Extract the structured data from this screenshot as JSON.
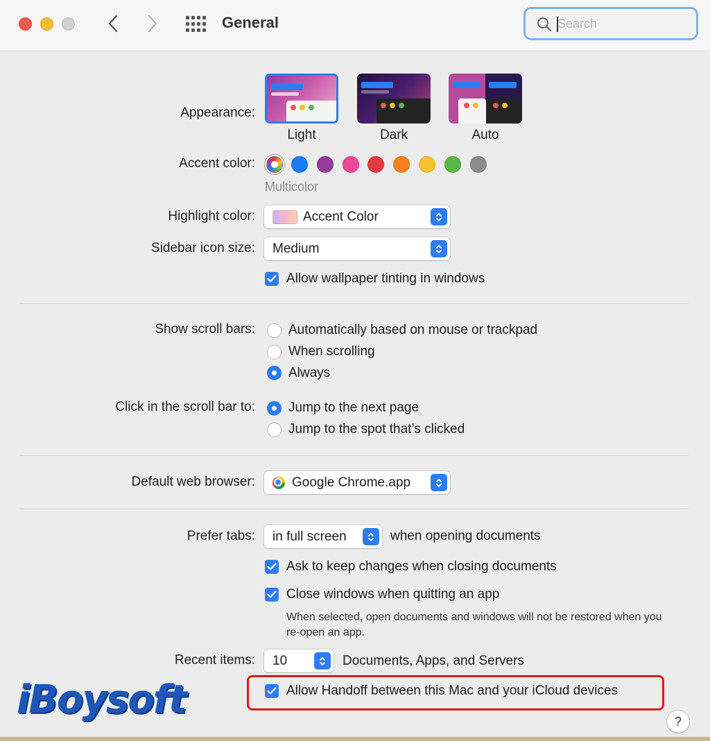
{
  "window": {
    "title": "General"
  },
  "search": {
    "placeholder": "Search",
    "value": ""
  },
  "appearance": {
    "label": "Appearance:",
    "options": [
      "Light",
      "Dark",
      "Auto"
    ],
    "selected": "Light"
  },
  "accent": {
    "label": "Accent color:",
    "colors": [
      "multicolor",
      "#1a7cf3",
      "#923d9c",
      "#e94a9a",
      "#e23a3e",
      "#f7821b",
      "#fbc12f",
      "#5cb548",
      "#8c8c8c"
    ],
    "selected_caption": "Multicolor"
  },
  "highlight": {
    "label": "Highlight color:",
    "value": "Accent Color"
  },
  "sidebar_icon": {
    "label": "Sidebar icon size:",
    "value": "Medium"
  },
  "wallpaper_tinting": {
    "label": "Allow wallpaper tinting in windows",
    "checked": true
  },
  "scroll_bars": {
    "label": "Show scroll bars:",
    "options": [
      "Automatically based on mouse or trackpad",
      "When scrolling",
      "Always"
    ],
    "selected": "Always"
  },
  "click_scroll": {
    "label": "Click in the scroll bar to:",
    "options": [
      "Jump to the next page",
      "Jump to the spot that’s clicked"
    ],
    "selected": "Jump to the next page"
  },
  "browser": {
    "label": "Default web browser:",
    "value": "Google Chrome.app"
  },
  "tabs": {
    "label": "Prefer tabs:",
    "value": "in full screen",
    "suffix": "when opening documents"
  },
  "ask_keep": {
    "label": "Ask to keep changes when closing documents",
    "checked": true
  },
  "close_windows": {
    "label": "Close windows when quitting an app",
    "checked": true,
    "note": "When selected, open documents and windows will not be restored when you re-open an app."
  },
  "recent": {
    "label": "Recent items:",
    "value": "10",
    "suffix": "Documents, Apps, and Servers"
  },
  "handoff": {
    "label": "Allow Handoff between this Mac and your iCloud devices",
    "checked": true
  },
  "watermark": "iBoysoft",
  "help": "?",
  "colors": {
    "accent_blue": "#2f7cf0",
    "callout_red": "#e01a1a"
  }
}
